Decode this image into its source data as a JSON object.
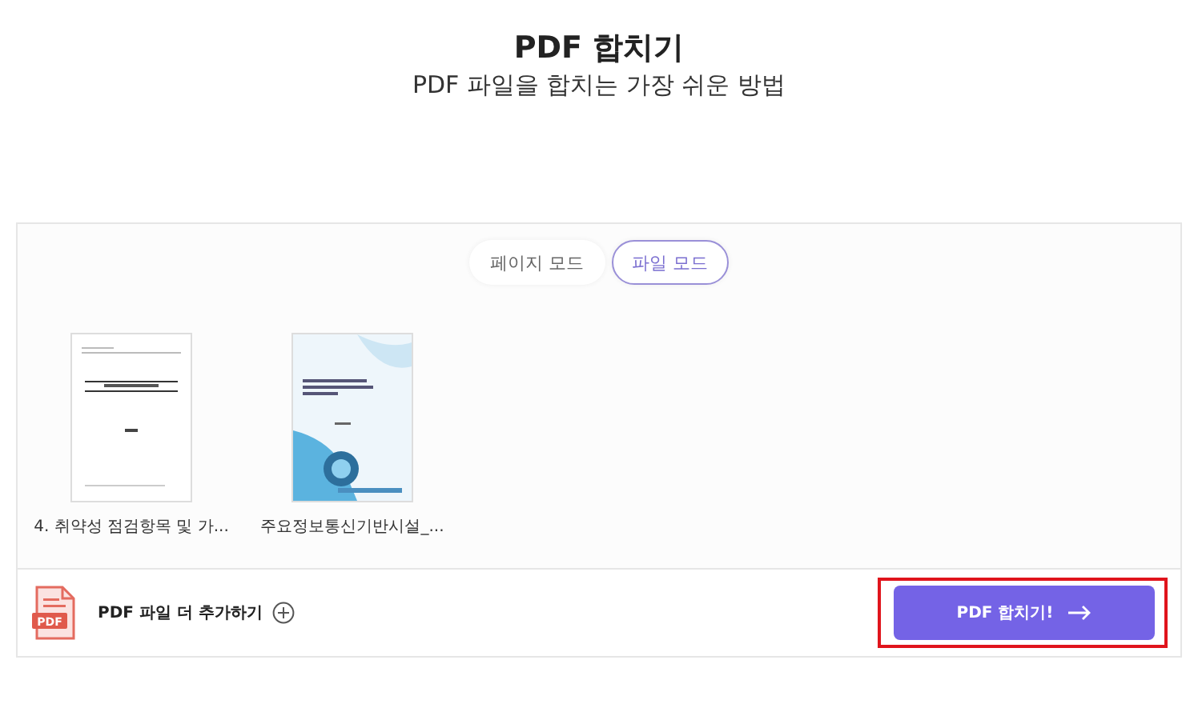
{
  "header": {
    "title": "PDF 합치기",
    "subtitle": "PDF 파일을 합치는 가장 쉬운 방법"
  },
  "mode_tabs": [
    {
      "label": "페이지 모드",
      "selected": false
    },
    {
      "label": "파일 모드",
      "selected": true
    }
  ],
  "files": [
    {
      "name": "4. 취약성 점검항목 및 가...",
      "kind": "plain"
    },
    {
      "name": "주요정보통신기반시설_...",
      "kind": "cover"
    }
  ],
  "footer": {
    "add_icon_label": "PDF",
    "add_label": "PDF 파일 더 추가하기",
    "merge_button": "PDF 합치기!"
  }
}
